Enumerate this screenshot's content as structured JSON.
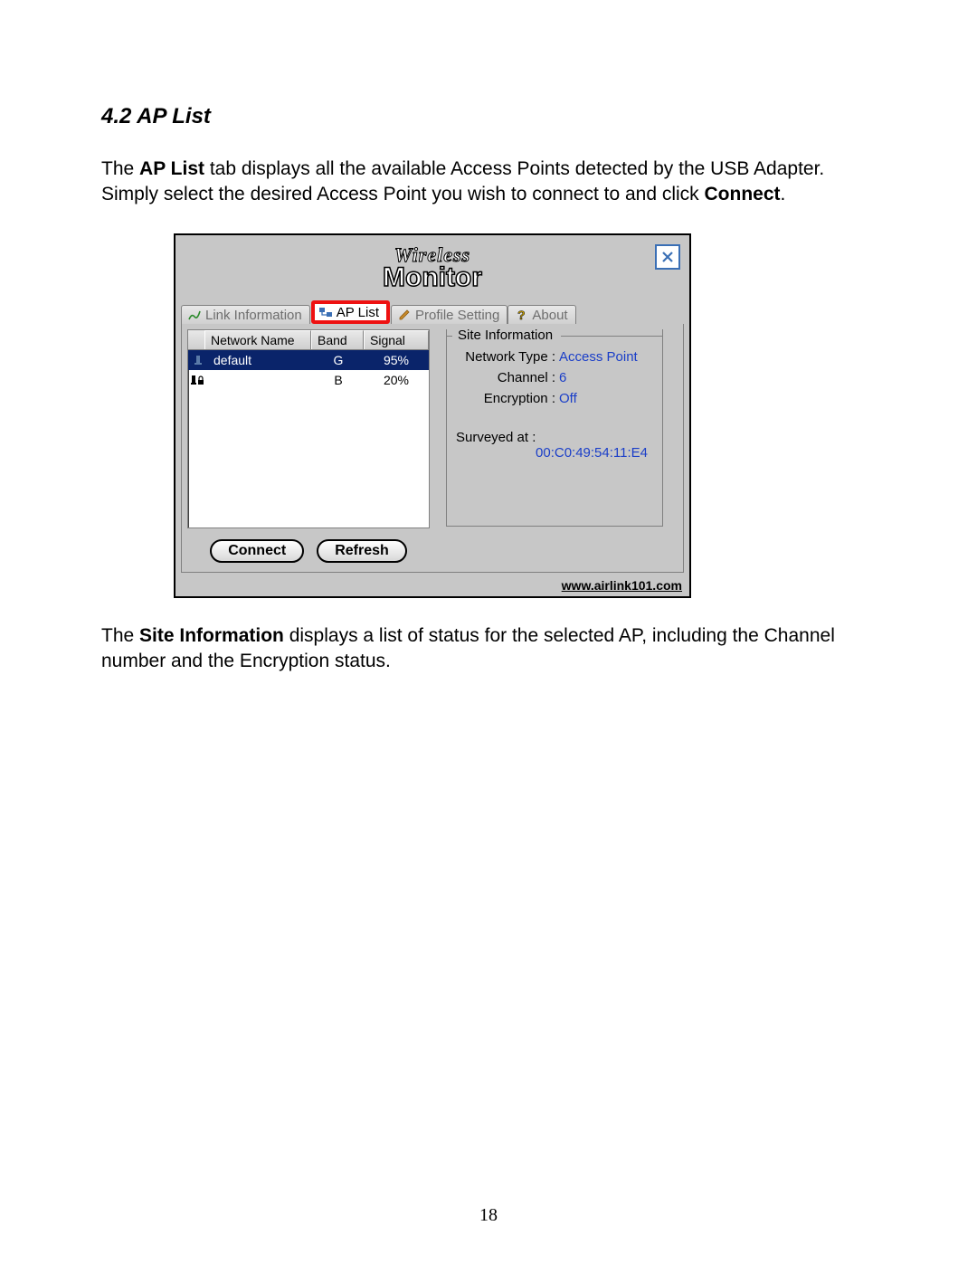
{
  "section_heading": "4.2 AP List",
  "para1_pre": "The ",
  "para1_b1": "AP List",
  "para1_mid": " tab displays all the available Access Points detected by the USB Adapter. Simply select the desired Access Point you wish to connect to and click ",
  "para1_b2": "Connect",
  "para1_post": ".",
  "para2_pre": "The ",
  "para2_b1": "Site Information",
  "para2_post": " displays a list of status for the selected AP, including the Channel number and the Encryption status.",
  "page_number": "18",
  "win": {
    "title_top": "Wireless",
    "title_bot": "Monitor",
    "tabs": {
      "link_info": "Link Information",
      "ap_list": "AP List",
      "profile": "Profile Setting",
      "about": "About"
    },
    "cols": {
      "name": "Network Name",
      "band": "Band",
      "signal": "Signal"
    },
    "rows": [
      {
        "name": "default",
        "band": "G",
        "signal": "95%",
        "locked": false,
        "selected": true
      },
      {
        "name": "",
        "band": "B",
        "signal": "20%",
        "locked": true,
        "selected": false
      }
    ],
    "connect_btn": "Connect",
    "refresh_btn": "Refresh",
    "group_title": "Site Information",
    "info": {
      "nettype_lbl": "Network Type :",
      "nettype_val": "Access Point",
      "channel_lbl": "Channel :",
      "channel_val": "6",
      "enc_lbl": "Encryption :",
      "enc_val": "Off",
      "survey_lbl": "Surveyed at :",
      "survey_val": "00:C0:49:54:11:E4"
    },
    "footer_url": "www.airlink101.com"
  }
}
